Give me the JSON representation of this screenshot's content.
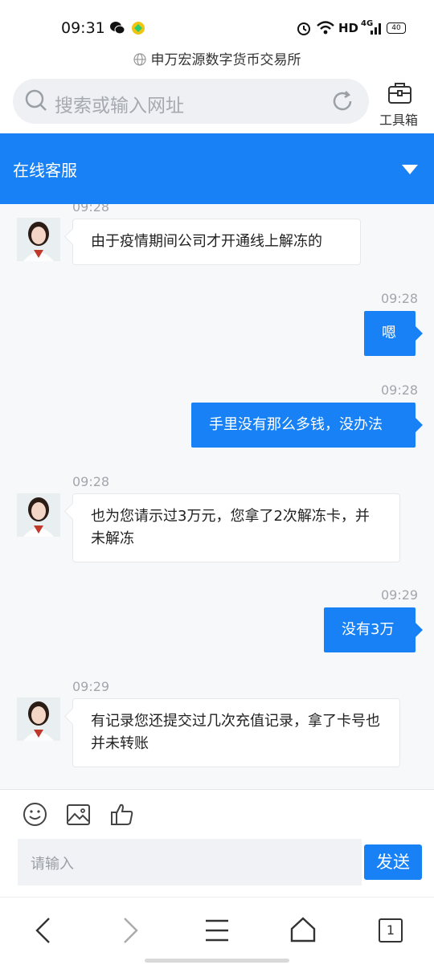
{
  "status_bar": {
    "time": "09:31",
    "network": "HD",
    "signal": "4G",
    "battery": "40",
    "icons": [
      "wechat-icon",
      "app-badge-icon",
      "alarm-icon",
      "wifi-icon",
      "signal-icon",
      "battery-icon"
    ]
  },
  "browser": {
    "site_title": "申万宏源数字货币交易所",
    "search_placeholder": "搜索或输入网址",
    "toolbox_label": "工具箱"
  },
  "chat_header": {
    "title": "在线客服"
  },
  "messages": [
    {
      "side": "in",
      "time": "09:28",
      "text": "由于疫情期间公司才开通线上解冻的"
    },
    {
      "side": "out",
      "time": "09:28",
      "text": "嗯"
    },
    {
      "side": "out",
      "time": "09:28",
      "text": "手里没有那么多钱，没办法"
    },
    {
      "side": "in",
      "time": "09:28",
      "text": "也为您请示过3万元，您拿了2次解冻卡，并未解冻"
    },
    {
      "side": "out",
      "time": "09:29",
      "text": "没有3万"
    },
    {
      "side": "in",
      "time": "09:29",
      "text": "有记录您还提交过几次充值记录，拿了卡号也并未转账"
    }
  ],
  "composer": {
    "placeholder": "请输入",
    "send_label": "发送"
  },
  "bottom_nav": {
    "tab_count": "1"
  },
  "colors": {
    "accent": "#1781f5",
    "bubble_in": "#ffffff",
    "background": "#f7f8fa"
  }
}
